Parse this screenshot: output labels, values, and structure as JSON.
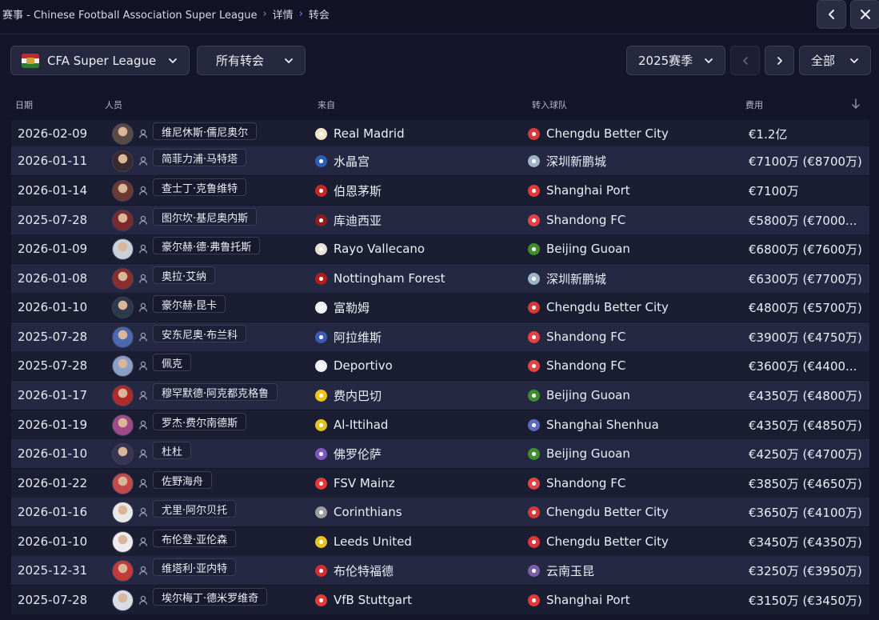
{
  "breadcrumb": {
    "root": "赛事 - Chinese Football Association Super League",
    "mid": "详情",
    "current": "转会"
  },
  "top_buttons": {
    "back_icon": "chevron-left-icon",
    "close_icon": "close-icon"
  },
  "filters": {
    "league": "CFA Super League",
    "transfer_type": "所有转会",
    "season": "2025赛季",
    "scope": "全部"
  },
  "columns": {
    "date": "日期",
    "person": "人员",
    "from": "来自",
    "to": "转入球队",
    "fee": "费用"
  },
  "colors": {
    "background": "#14152a",
    "row_odd": "#1b1d33",
    "row_even": "#252842",
    "accent": "#9b7cff"
  },
  "rows": [
    {
      "date": "2026-02-09",
      "person": "维尼休斯·儒尼奥尔",
      "from": "Real Madrid",
      "to": "Chengdu Better City",
      "fee": "€1.2亿",
      "avatar_color": "#5a4a44",
      "from_crest": "#f2e6c9",
      "to_crest": "#d33a3a"
    },
    {
      "date": "2026-01-11",
      "person": "简菲力浦·马特塔",
      "from": "水晶宫",
      "to": "深圳新鹏城",
      "fee": "€7100万 (€8700万)",
      "avatar_color": "#3a2a2e",
      "from_crest": "#2b5fb5",
      "to_crest": "#9fb3c8"
    },
    {
      "date": "2026-01-14",
      "person": "查士丁·克鲁维特",
      "from": "伯恩茅斯",
      "to": "Shanghai Port",
      "fee": "€7100万",
      "avatar_color": "#6b3a34",
      "from_crest": "#c62828",
      "to_crest": "#e53935"
    },
    {
      "date": "2025-07-28",
      "person": "图尔坎·基尼奥内斯",
      "from": "库迪西亚",
      "to": "Shandong FC",
      "fee": "€5800万 (€7000...",
      "avatar_color": "#7a2a2a",
      "from_crest": "#8b1e1e",
      "to_crest": "#e04444"
    },
    {
      "date": "2026-01-09",
      "person": "豪尔赫·德·弗鲁托斯",
      "from": "Rayo Vallecano",
      "to": "Beijing Guoan",
      "fee": "€6800万 (€7600万)",
      "avatar_color": "#c9d0d8",
      "from_crest": "#e8e2d6",
      "to_crest": "#3e8e2e"
    },
    {
      "date": "2026-01-08",
      "person": "奥拉·艾纳",
      "from": "Nottingham Forest",
      "to": "深圳新鹏城",
      "fee": "€6300万 (€7700万)",
      "avatar_color": "#8a2e2e",
      "from_crest": "#b71c1c",
      "to_crest": "#9fb3c8"
    },
    {
      "date": "2026-01-10",
      "person": "豪尔赫·昆卡",
      "from": "富勒姆",
      "to": "Chengdu Better City",
      "fee": "€4800万 (€5700万)",
      "avatar_color": "#2e3a4a",
      "from_crest": "#f2f2f2",
      "to_crest": "#d33a3a"
    },
    {
      "date": "2025-07-28",
      "person": "安东尼奥·布兰科",
      "from": "阿拉维斯",
      "to": "Shandong FC",
      "fee": "€3900万 (€4750万)",
      "avatar_color": "#4a6ab0",
      "from_crest": "#3b5bb5",
      "to_crest": "#e04444"
    },
    {
      "date": "2025-07-28",
      "person": "佩克",
      "from": "Deportivo",
      "to": "Shandong FC",
      "fee": "€3600万 (€4400...",
      "avatar_color": "#8aa0c4",
      "from_crest": "#f2f2f2",
      "to_crest": "#e04444"
    },
    {
      "date": "2026-01-17",
      "person": "穆罕默德·阿克都克格鲁",
      "from": "费内巴切",
      "to": "Beijing Guoan",
      "fee": "€4350万 (€4800万)",
      "avatar_color": "#b02a2a",
      "from_crest": "#f2c40f",
      "to_crest": "#3e8e2e"
    },
    {
      "date": "2026-01-19",
      "person": "罗杰·费尔南德斯",
      "from": "Al-Ittihad",
      "to": "Shanghai Shenhua",
      "fee": "€4350万 (€4850万)",
      "avatar_color": "#a14a8a",
      "from_crest": "#e0c12a",
      "to_crest": "#5c6bc0"
    },
    {
      "date": "2026-01-10",
      "person": "杜杜",
      "from": "佛罗伦萨",
      "to": "Beijing Guoan",
      "fee": "€4250万 (€4700万)",
      "avatar_color": "#3a3550",
      "from_crest": "#7e57c2",
      "to_crest": "#3e8e2e"
    },
    {
      "date": "2026-01-22",
      "person": "佐野海舟",
      "from": "FSV Mainz",
      "to": "Shandong FC",
      "fee": "€3850万 (€4650万)",
      "avatar_color": "#c24a4a",
      "from_crest": "#e53935",
      "to_crest": "#e04444"
    },
    {
      "date": "2026-01-16",
      "person": "尤里·阿尔贝托",
      "from": "Corinthians",
      "to": "Chengdu Better City",
      "fee": "€3650万 (€4100万)",
      "avatar_color": "#e8e8e8",
      "from_crest": "#9e9e9e",
      "to_crest": "#d33a3a"
    },
    {
      "date": "2026-01-10",
      "person": "布伦登·亚伦森",
      "from": "Leeds United",
      "to": "Chengdu Better City",
      "fee": "€3450万 (€4350万)",
      "avatar_color": "#ececec",
      "from_crest": "#e8c229",
      "to_crest": "#d33a3a"
    },
    {
      "date": "2025-12-31",
      "person": "维塔利·亚内特",
      "from": "布伦特福德",
      "to": "云南玉昆",
      "fee": "€3250万 (€3950万)",
      "avatar_color": "#c23a3a",
      "from_crest": "#d32f2f",
      "to_crest": "#7b5ea7"
    },
    {
      "date": "2025-07-28",
      "person": "埃尔梅丁·德米罗维奇",
      "from": "VfB Stuttgart",
      "to": "Shanghai Port",
      "fee": "€3150万 (€3450万)",
      "avatar_color": "#d8dce4",
      "from_crest": "#e53935",
      "to_crest": "#e53935"
    }
  ]
}
